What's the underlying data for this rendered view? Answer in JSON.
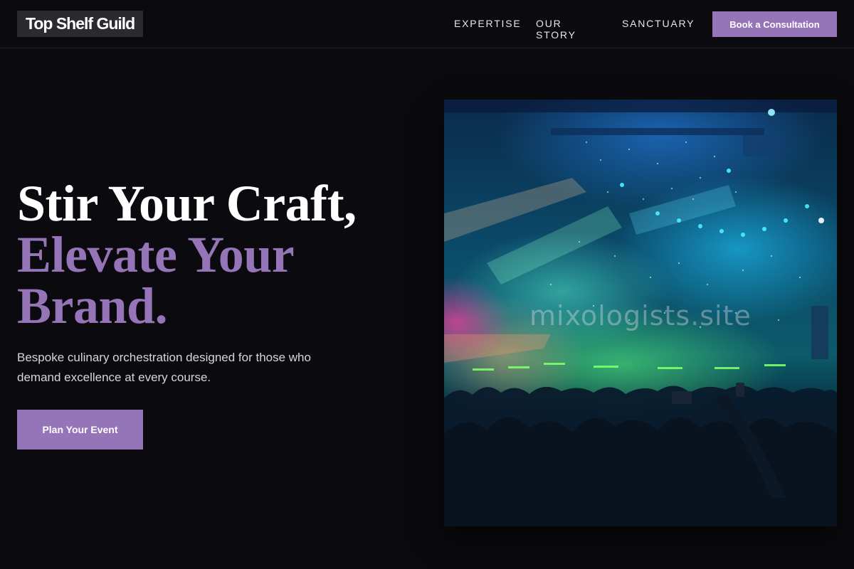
{
  "header": {
    "logo_text": "Top Shelf Guild",
    "nav": [
      {
        "label": "EXPERTISE"
      },
      {
        "label": "OUR STORY"
      },
      {
        "label": "SANCTUARY"
      }
    ],
    "cta_label": "Book a Consultation"
  },
  "hero": {
    "headline_line1": "Stir Your Craft,",
    "headline_line2": "Elevate Your",
    "headline_line3": "Brand.",
    "subtext": "Bespoke culinary orchestration designed for those who demand excellence at every course.",
    "primary_button": "Plan Your Event",
    "image": {
      "watermark": "mixologists.site"
    }
  },
  "colors": {
    "background": "#0b0b0f",
    "accent": "#9575b8",
    "text": "#ffffff"
  },
  "icons": []
}
